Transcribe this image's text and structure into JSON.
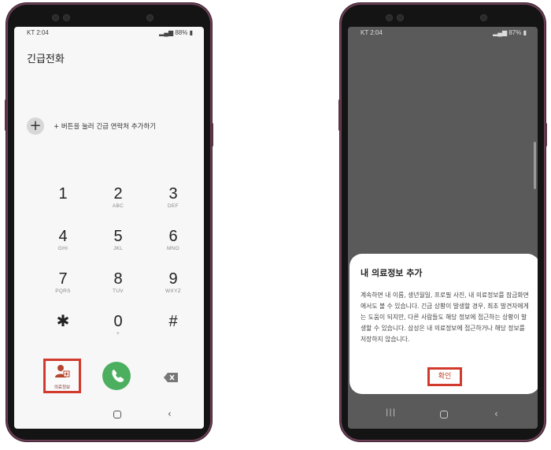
{
  "left_phone": {
    "status": {
      "carrier_time": "KT 2:04",
      "battery": "88%"
    },
    "title": "긴급전화",
    "add_hint": "+ 버튼을 눌러 긴급 연락처 추가하기",
    "keys": [
      {
        "num": "1",
        "sub": ""
      },
      {
        "num": "2",
        "sub": "ABC"
      },
      {
        "num": "3",
        "sub": "DEF"
      },
      {
        "num": "4",
        "sub": "GHI"
      },
      {
        "num": "5",
        "sub": "JKL"
      },
      {
        "num": "6",
        "sub": "MNO"
      },
      {
        "num": "7",
        "sub": "PQRS"
      },
      {
        "num": "8",
        "sub": "TUV"
      },
      {
        "num": "9",
        "sub": "WXYZ"
      },
      {
        "num": "✱",
        "sub": ""
      },
      {
        "num": "0",
        "sub": "+"
      },
      {
        "num": "#",
        "sub": ""
      }
    ],
    "medical_info_label": "의료정보",
    "colors": {
      "highlight": "#d23a2e",
      "call": "#4caf60"
    }
  },
  "right_phone": {
    "status": {
      "carrier_time": "KT 2:04",
      "battery": "87%"
    },
    "dialog": {
      "title": "내 의료정보 추가",
      "body": "계속하면 내 이름, 생년월일, 프로필 사진, 내 의료정보를 잠금화면에서도 볼 수 있습니다. 긴급 상황이 발생할 경우, 최초 발견자에게는 도움이 되지만, 다른 사람들도 해당 정보에 접근하는 상황이 발생할 수 있습니다. 삼성은 내 의료정보에 접근하거나 해당 정보를 저장하지 않습니다.",
      "confirm_label": "확인"
    }
  }
}
